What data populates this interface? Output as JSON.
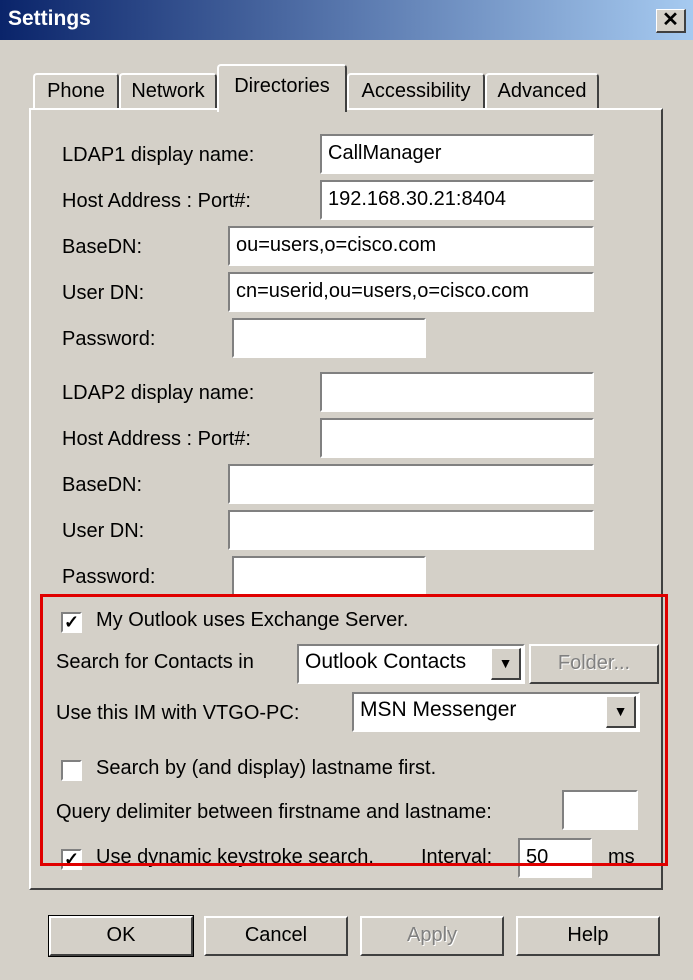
{
  "window": {
    "title": "Settings",
    "close_label": "✕"
  },
  "tabs": [
    "Phone",
    "Network",
    "Directories",
    "Accessibility",
    "Advanced"
  ],
  "ldap1": {
    "display_name_label": "LDAP1 display name:",
    "display_name_value": "CallManager",
    "host_label": "Host Address : Port#:",
    "host_value": "192.168.30.21:8404",
    "basedn_label": "BaseDN:",
    "basedn_value": "ou=users,o=cisco.com",
    "userdn_label": "User DN:",
    "userdn_value": "cn=userid,ou=users,o=cisco.com",
    "password_label": "Password:",
    "password_value": ""
  },
  "ldap2": {
    "display_name_label": "LDAP2 display name:",
    "display_name_value": "",
    "host_label": "Host Address : Port#:",
    "host_value": "",
    "basedn_label": "BaseDN:",
    "basedn_value": "",
    "userdn_label": "User DN:",
    "userdn_value": "",
    "password_label": "Password:",
    "password_value": ""
  },
  "options": {
    "exchange_label": "My Outlook uses Exchange Server.",
    "exchange_checked": "✓",
    "search_contacts_label": "Search for Contacts in",
    "search_contacts_value": "Outlook Contacts",
    "folder_button": "Folder...",
    "im_label": "Use this IM with VTGO-PC:",
    "im_value": "MSN Messenger",
    "lastname_label": "Search by (and display) lastname first.",
    "lastname_checked": "",
    "delimiter_label": "Query delimiter between firstname and lastname:",
    "delimiter_value": "",
    "dynamic_label": "Use dynamic keystroke search.",
    "dynamic_checked": "✓",
    "interval_label": "Interval:",
    "interval_value": "50",
    "interval_unit": "ms"
  },
  "buttons": {
    "ok": "OK",
    "cancel": "Cancel",
    "apply": "Apply",
    "help": "Help"
  },
  "colors": {
    "highlight": "#e00000",
    "titlebar": "#0a246a",
    "face": "#d4d0c8"
  }
}
